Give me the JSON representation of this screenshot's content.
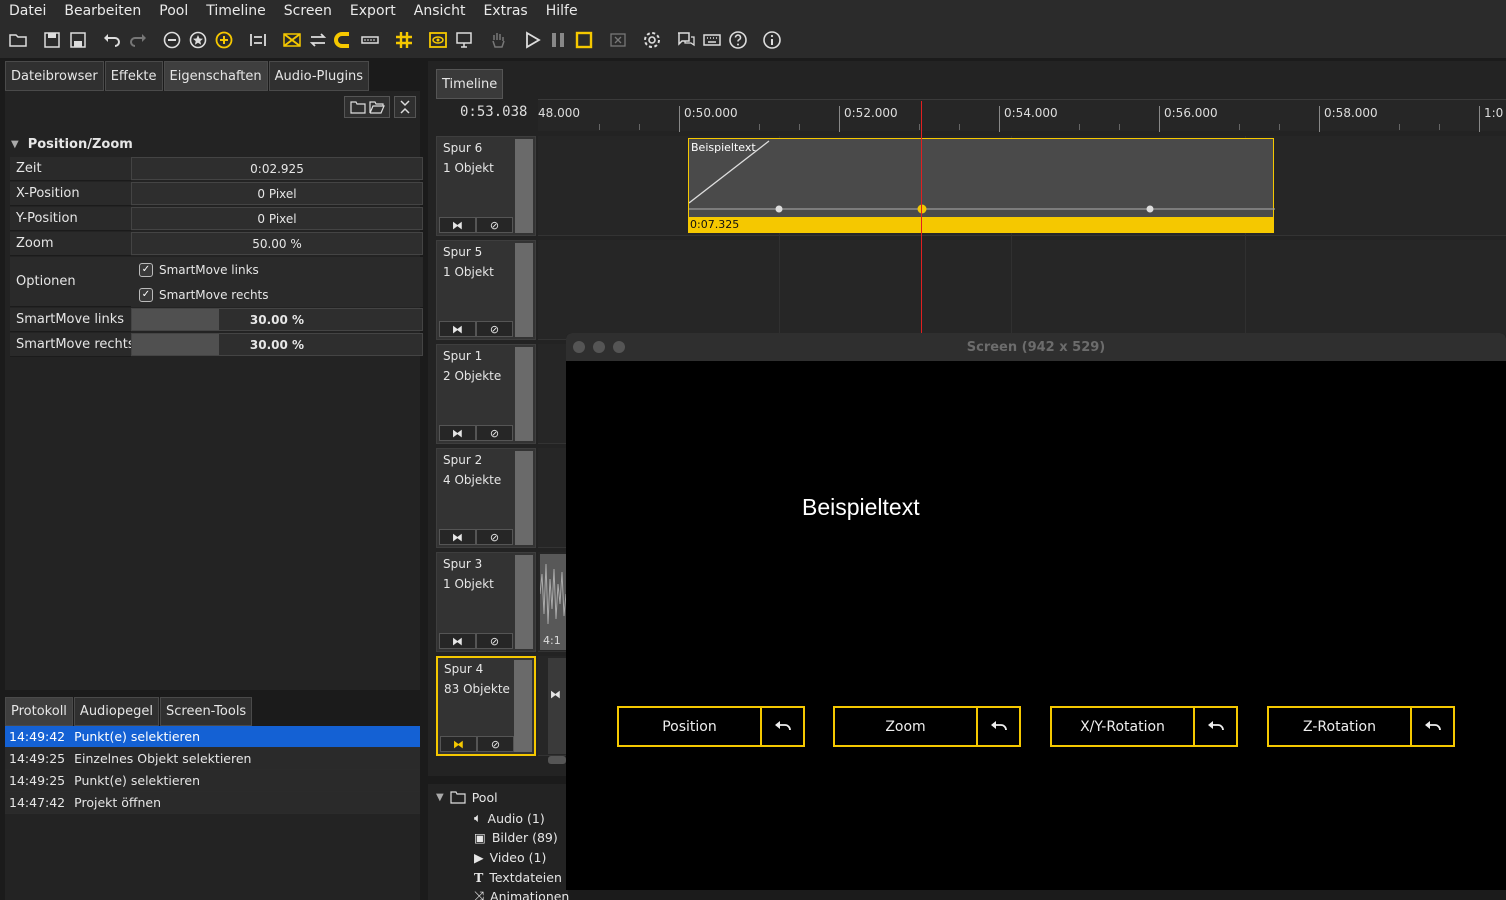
{
  "menu": [
    "Datei",
    "Bearbeiten",
    "Pool",
    "Timeline",
    "Screen",
    "Export",
    "Ansicht",
    "Extras",
    "Hilfe"
  ],
  "colors": {
    "accent": "#f5c800",
    "selection": "#1461d4",
    "playhead": "#e02020"
  },
  "left_tabs": [
    "Dateibrowser",
    "Effekte",
    "Eigenschaften",
    "Audio-Plugins"
  ],
  "properties": {
    "section": "Position/Zoom",
    "zeit_label": "Zeit",
    "zeit_value": "0:02.925",
    "x_label": "X-Position",
    "x_value": "0 Pixel",
    "y_label": "Y-Position",
    "y_value": "0 Pixel",
    "zoom_label": "Zoom",
    "zoom_value": "50.00 %",
    "options_label": "Optionen",
    "cb_left": "SmartMove links",
    "cb_right": "SmartMove rechts",
    "sm_left_label": "SmartMove links",
    "sm_left_value": "30.00 %",
    "sm_left_fraction": 0.3,
    "sm_right_label": "SmartMove rechts",
    "sm_right_value": "30.00 %",
    "sm_right_fraction": 0.3
  },
  "bottom_tabs": [
    "Protokoll",
    "Audiopegel",
    "Screen-Tools"
  ],
  "log": [
    {
      "time": "14:49:42",
      "text": "Punkt(e) selektieren"
    },
    {
      "time": "14:49:25",
      "text": "Einzelnes Objekt selektieren"
    },
    {
      "time": "14:49:25",
      "text": "Punkt(e) selektieren"
    },
    {
      "time": "14:47:42",
      "text": "Projekt öffnen"
    }
  ],
  "timeline": {
    "tab": "Timeline",
    "current_time": "0:53.038",
    "ruler": [
      "48.000",
      "0:50.000",
      "0:52.000",
      "0:54.000",
      "0:56.000",
      "0:58.000",
      "1:0"
    ],
    "tracks": [
      {
        "name": "Spur 6",
        "count": "1 Objekt"
      },
      {
        "name": "Spur 5",
        "count": "1 Objekt"
      },
      {
        "name": "Spur 1",
        "count": "2 Objekte"
      },
      {
        "name": "Spur 2",
        "count": "4 Objekte"
      },
      {
        "name": "Spur 3",
        "count": "1 Objekt"
      },
      {
        "name": "Spur 4",
        "count": "83 Objekte"
      }
    ],
    "clip_title": "Beispieltext",
    "clip_duration": "0:07.325",
    "audio_clip_label": "4:1"
  },
  "pool": {
    "root": "Pool",
    "items": [
      "Audio (1)",
      "Bilder (89)",
      "Video (1)",
      "Textdateien",
      "Animationen"
    ]
  },
  "screen": {
    "title": "Screen (942 x 529)",
    "preview_text": "Beispieltext",
    "buttons": [
      "Position",
      "Zoom",
      "X/Y-Rotation",
      "Z-Rotation"
    ]
  }
}
